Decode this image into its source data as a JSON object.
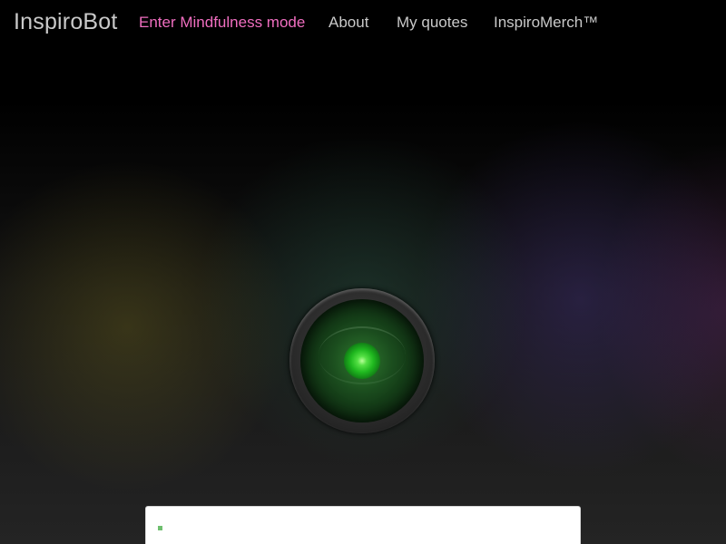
{
  "navbar": {
    "brand": "InspiroBot",
    "links": [
      {
        "label": "Enter Mindfulness mode",
        "accent": true
      },
      {
        "label": "About",
        "accent": false
      },
      {
        "label": "My quotes",
        "accent": false
      },
      {
        "label": "InspiroMerch™",
        "accent": false
      }
    ]
  },
  "colors": {
    "background": "#000000",
    "nav_text": "#c9c9c9",
    "accent": "#f06ec0",
    "eye_glow": "#2fd12f",
    "panel": "#ffffff"
  },
  "icons": {
    "bot_eye": "robot-eye-icon",
    "loading": "loading-dot-icon"
  }
}
